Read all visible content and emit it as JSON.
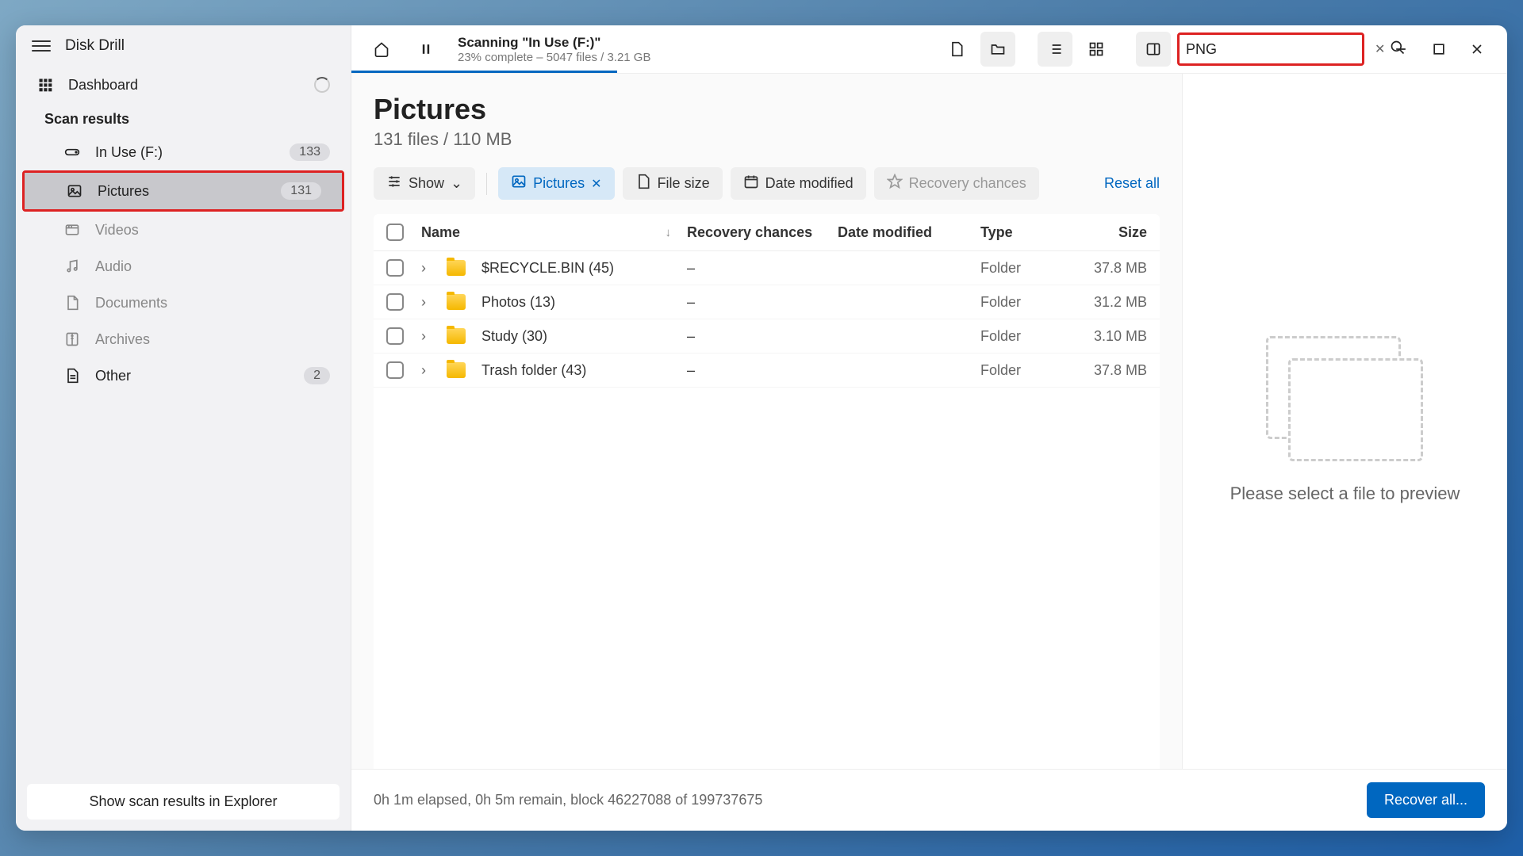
{
  "app_title": "Disk Drill",
  "scan": {
    "title": "Scanning \"In Use (F:)\"",
    "subtitle": "23% complete – 5047 files / 3.21 GB",
    "progress_pct": 23
  },
  "search": {
    "value": "PNG"
  },
  "sidebar": {
    "dashboard": "Dashboard",
    "section": "Scan results",
    "items": [
      {
        "label": "In Use (F:)",
        "badge": "133",
        "active": false,
        "muted": false
      },
      {
        "label": "Pictures",
        "badge": "131",
        "active": true,
        "muted": false
      },
      {
        "label": "Videos",
        "badge": "",
        "active": false,
        "muted": true
      },
      {
        "label": "Audio",
        "badge": "",
        "active": false,
        "muted": true
      },
      {
        "label": "Documents",
        "badge": "",
        "active": false,
        "muted": true
      },
      {
        "label": "Archives",
        "badge": "",
        "active": false,
        "muted": true
      },
      {
        "label": "Other",
        "badge": "2",
        "active": false,
        "muted": false
      }
    ],
    "footer_btn": "Show scan results in Explorer"
  },
  "page": {
    "title": "Pictures",
    "subtitle": "131 files / 110 MB"
  },
  "filters": {
    "show": "Show",
    "pictures": "Pictures",
    "file_size": "File size",
    "date_modified": "Date modified",
    "recovery": "Recovery chances",
    "reset": "Reset all"
  },
  "columns": {
    "name": "Name",
    "recovery": "Recovery chances",
    "date": "Date modified",
    "type": "Type",
    "size": "Size"
  },
  "rows": [
    {
      "name": "$RECYCLE.BIN (45)",
      "recovery": "–",
      "date": "",
      "type": "Folder",
      "size": "37.8 MB"
    },
    {
      "name": "Photos (13)",
      "recovery": "–",
      "date": "",
      "type": "Folder",
      "size": "31.2 MB"
    },
    {
      "name": "Study (30)",
      "recovery": "–",
      "date": "",
      "type": "Folder",
      "size": "3.10 MB"
    },
    {
      "name": "Trash folder (43)",
      "recovery": "–",
      "date": "",
      "type": "Folder",
      "size": "37.8 MB"
    }
  ],
  "preview": {
    "text": "Please select a file to preview"
  },
  "footer": {
    "status": "0h 1m elapsed, 0h 5m remain, block 46227088 of 199737675",
    "recover": "Recover all..."
  }
}
